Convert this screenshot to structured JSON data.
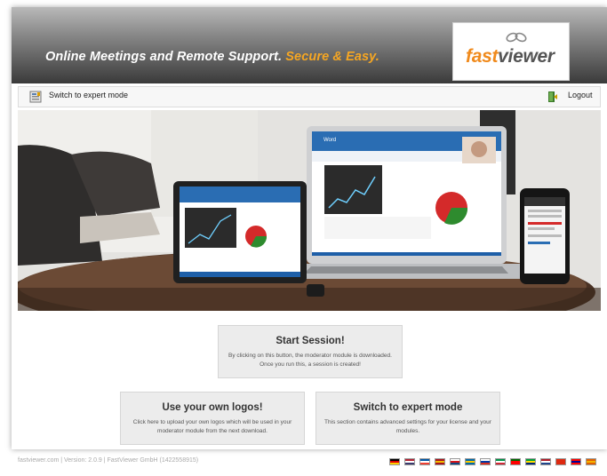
{
  "banner": {
    "tagline_main": "Online Meetings and Remote Support.",
    "tagline_accent": "Secure & Easy.",
    "logo_fast": "fast",
    "logo_viewer": "viewer",
    "accent_color": "#f5a623"
  },
  "toolbar": {
    "expert_mode_label": "Switch to expert mode",
    "logout_label": "Logout"
  },
  "hero": {
    "app_window_title": "Word"
  },
  "cards": {
    "start": {
      "title": "Start Session!",
      "description": "By clicking on this button, the moderator module is downloaded. Once you run this, a session is created!"
    },
    "logos": {
      "title": "Use your own logos!",
      "description": "Click here to upload your own logos which will be used in your moderator module from the next download."
    },
    "expert": {
      "title": "Switch to expert mode",
      "description": "This section contains advanced settings for your license and your modules."
    }
  },
  "footer": {
    "text": "fastviewer.com | Version: 2.0.9 | FastViewer GmbH (1422558915)",
    "flags": [
      {
        "name": "de",
        "c1": "#000000",
        "c2": "#dd0000",
        "c3": "#ffce00"
      },
      {
        "name": "us",
        "c1": "#b22234",
        "c2": "#ffffff",
        "c3": "#3c3b6e"
      },
      {
        "name": "fr",
        "c1": "#0055a4",
        "c2": "#ffffff",
        "c3": "#ef4135"
      },
      {
        "name": "es",
        "c1": "#aa151b",
        "c2": "#f1bf00",
        "c3": "#aa151b"
      },
      {
        "name": "cz",
        "c1": "#ffffff",
        "c2": "#d7141a",
        "c3": "#11457e"
      },
      {
        "name": "se",
        "c1": "#006aa7",
        "c2": "#fecc00",
        "c3": "#006aa7"
      },
      {
        "name": "ru",
        "c1": "#ffffff",
        "c2": "#0039a6",
        "c3": "#d52b1e"
      },
      {
        "name": "it",
        "c1": "#009246",
        "c2": "#ffffff",
        "c3": "#ce2b37"
      },
      {
        "name": "pt",
        "c1": "#006600",
        "c2": "#ff0000",
        "c3": "#ff0000"
      },
      {
        "name": "br",
        "c1": "#009c3b",
        "c2": "#ffdf00",
        "c3": "#002776"
      },
      {
        "name": "nl",
        "c1": "#ae1c28",
        "c2": "#ffffff",
        "c3": "#21468b"
      },
      {
        "name": "cn",
        "c1": "#de2910",
        "c2": "#de2910",
        "c3": "#de2910"
      },
      {
        "name": "tw",
        "c1": "#fe0000",
        "c2": "#000095",
        "c3": "#fe0000"
      },
      {
        "name": "es2",
        "c1": "#e06000",
        "c2": "#f5b400",
        "c3": "#e06000"
      }
    ]
  }
}
